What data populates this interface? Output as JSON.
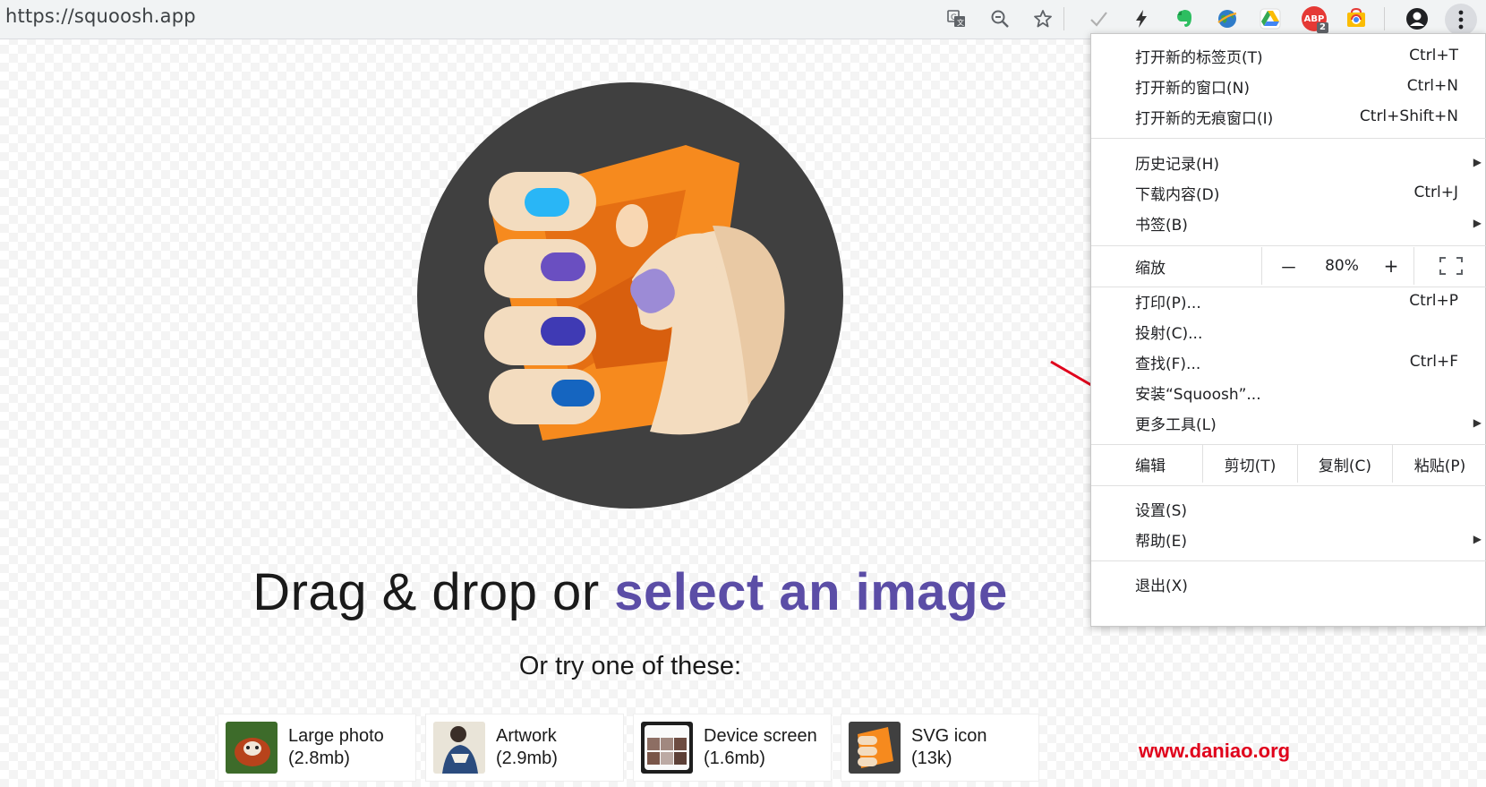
{
  "browser": {
    "url": "https://squoosh.app",
    "extensions": [
      {
        "name": "translate-icon"
      },
      {
        "name": "zoom-icon"
      },
      {
        "name": "star-icon"
      },
      {
        "name": "check-ext-icon"
      },
      {
        "name": "bolt-ext-icon"
      },
      {
        "name": "evernote-ext-icon",
        "color": "#2dbe60"
      },
      {
        "name": "globe-ext-icon",
        "color": "#2f7cc9"
      },
      {
        "name": "google-drive-ext-icon",
        "color": "#34a853"
      },
      {
        "name": "adblock-ext-icon",
        "color": "#e53935",
        "label": "ABP",
        "badge": "2"
      },
      {
        "name": "chrome-store-ext-icon",
        "color": "#fbbc04"
      },
      {
        "name": "account-icon"
      },
      {
        "name": "menu-kebab-icon"
      }
    ]
  },
  "page": {
    "headline_prefix": "Drag & drop or ",
    "headline_link": "select an image",
    "subhead": "Or try one of these:",
    "demos": [
      {
        "title": "Large photo",
        "size": "(2.8mb)"
      },
      {
        "title": "Artwork",
        "size": "(2.9mb)"
      },
      {
        "title": "Device screen",
        "size": "(1.6mb)"
      },
      {
        "title": "SVG icon",
        "size": "(13k)"
      }
    ]
  },
  "watermark": "www.daniao.org",
  "menu": {
    "group1": [
      {
        "label": "打开新的标签页(T)",
        "shortcut": "Ctrl+T"
      },
      {
        "label": "打开新的窗口(N)",
        "shortcut": "Ctrl+N"
      },
      {
        "label": "打开新的无痕窗口(I)",
        "shortcut": "Ctrl+Shift+N"
      }
    ],
    "group2": [
      {
        "label": "历史记录(H)",
        "shortcut": ""
      },
      {
        "label": "下载内容(D)",
        "shortcut": "Ctrl+J"
      },
      {
        "label": "书签(B)",
        "shortcut": ""
      }
    ],
    "zoom": {
      "label": "缩放",
      "minus": "－",
      "value": "80%",
      "plus": "+"
    },
    "group3": [
      {
        "label": "打印(P)...",
        "shortcut": "Ctrl+P"
      },
      {
        "label": "投射(C)...",
        "shortcut": ""
      },
      {
        "label": "查找(F)...",
        "shortcut": "Ctrl+F"
      },
      {
        "label": "安装“Squoosh”...",
        "shortcut": ""
      },
      {
        "label": "更多工具(L)",
        "shortcut": ""
      }
    ],
    "edit": {
      "label": "编辑",
      "cut": "剪切(T)",
      "copy": "复制(C)",
      "paste": "粘贴(P)"
    },
    "group4": [
      {
        "label": "设置(S)",
        "shortcut": ""
      },
      {
        "label": "帮助(E)",
        "shortcut": ""
      }
    ],
    "exit": {
      "label": "退出(X)"
    }
  }
}
